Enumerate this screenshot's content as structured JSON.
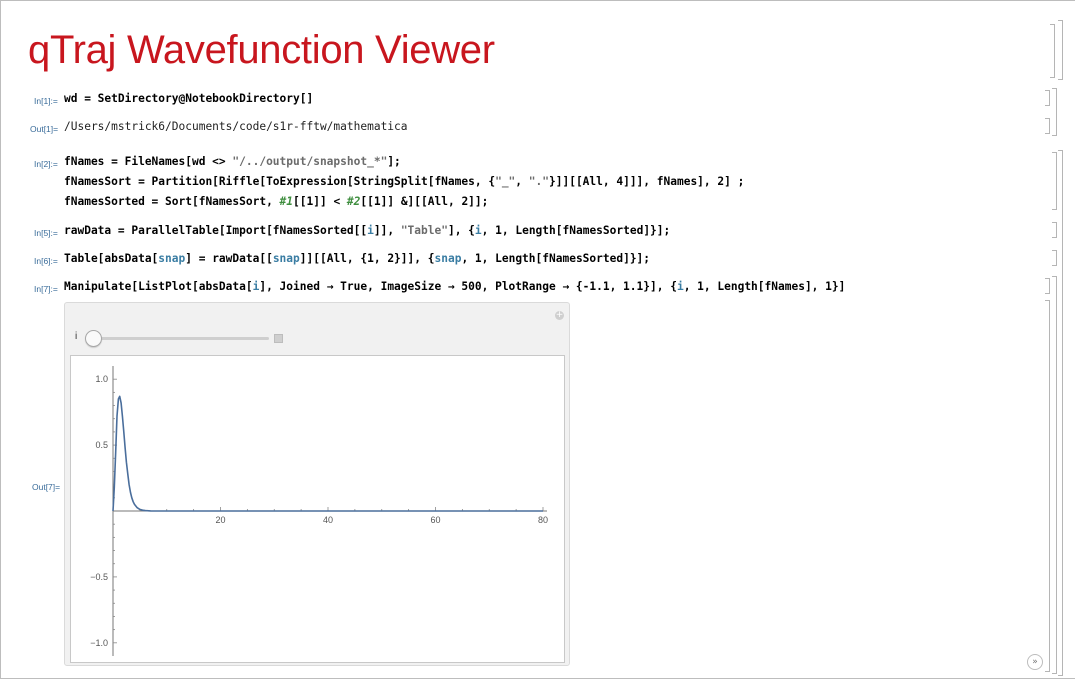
{
  "title": "qTraj Wavefunction Viewer",
  "cells": {
    "in1": {
      "label": "In[1]:=",
      "code": "wd = SetDirectory@NotebookDirectory[]"
    },
    "out1": {
      "label": "Out[1]=",
      "text": "/Users/mstrick6/Documents/code/s1r-fftw/mathematica"
    },
    "in2": {
      "label": "In[2]:=",
      "line1_a": "fNames = FileNames[wd <> ",
      "line1_str": "\"/../output/snapshot_*\"",
      "line1_b": "];",
      "line2_a": "fNamesSort = Partition[Riffle[ToExpression[StringSplit[fNames, {",
      "line2_s1": "\"_\"",
      "line2_b": ", ",
      "line2_s2": "\".\"",
      "line2_c": "}]][[All, 4]]], fNames], 2] ;",
      "line3_a": "fNamesSorted = Sort[fNamesSort, ",
      "line3_s1": "#1",
      "line3_b": "[[1]] < ",
      "line3_s2": "#2",
      "line3_c": "[[1]] &][[All, 2]];"
    },
    "in5": {
      "label": "In[5]:=",
      "a": "rawData = ParallelTable[Import[fNamesSorted[[",
      "v1": "i",
      "b": "]], ",
      "s": "\"Table\"",
      "c": "], {",
      "v2": "i",
      "d": ", 1, Length[fNamesSorted]}];"
    },
    "in6": {
      "label": "In[6]:=",
      "a": "Table[absData[",
      "v1": "snap",
      "b": "] = rawData[[",
      "v2": "snap",
      "c": "]][[All, {1, 2}]], {",
      "v3": "snap",
      "d": ", 1, Length[fNamesSorted]}];"
    },
    "in7": {
      "label": "In[7]:=",
      "a": "Manipulate[ListPlot[absData[",
      "v1": "i",
      "b": "], Joined → True, ImageSize → 500, PlotRange → {-1.1, 1.1}], {",
      "v2": "i",
      "c": ", 1, Length[fNames], 1}]"
    },
    "out7": {
      "label": "Out[7]="
    }
  },
  "manipulate": {
    "control_label": "i",
    "slider_value_fraction": 0.0,
    "plus_icon": "plus-circle-icon"
  },
  "chart_data": {
    "type": "line",
    "title": "",
    "xlabel": "",
    "ylabel": "",
    "xlim": [
      0,
      80
    ],
    "ylim": [
      -1.1,
      1.1
    ],
    "xticks": [
      20,
      40,
      60,
      80
    ],
    "yticks": [
      -1.0,
      -0.5,
      0.5,
      1.0
    ],
    "x": [
      0,
      0.25,
      0.5,
      0.75,
      1.0,
      1.25,
      1.5,
      1.75,
      2.0,
      2.25,
      2.5,
      2.75,
      3.0,
      3.25,
      3.5,
      3.75,
      4.0,
      4.5,
      5.0,
      5.5,
      6.0,
      7.0,
      8.0,
      10,
      15,
      20,
      30,
      40,
      50,
      60,
      70,
      80
    ],
    "series": [
      {
        "values": [
          0,
          0.18,
          0.45,
          0.72,
          0.85,
          0.87,
          0.82,
          0.72,
          0.6,
          0.48,
          0.37,
          0.28,
          0.2,
          0.14,
          0.1,
          0.07,
          0.05,
          0.025,
          0.012,
          0.006,
          0.003,
          0.001,
          0,
          0,
          0,
          0,
          0,
          0,
          0,
          0,
          0,
          0
        ],
        "color": "#4a6e9c"
      }
    ]
  },
  "ui": {
    "scroll_icon": "double-chevron-down-icon",
    "scroll_glyph": "»"
  }
}
